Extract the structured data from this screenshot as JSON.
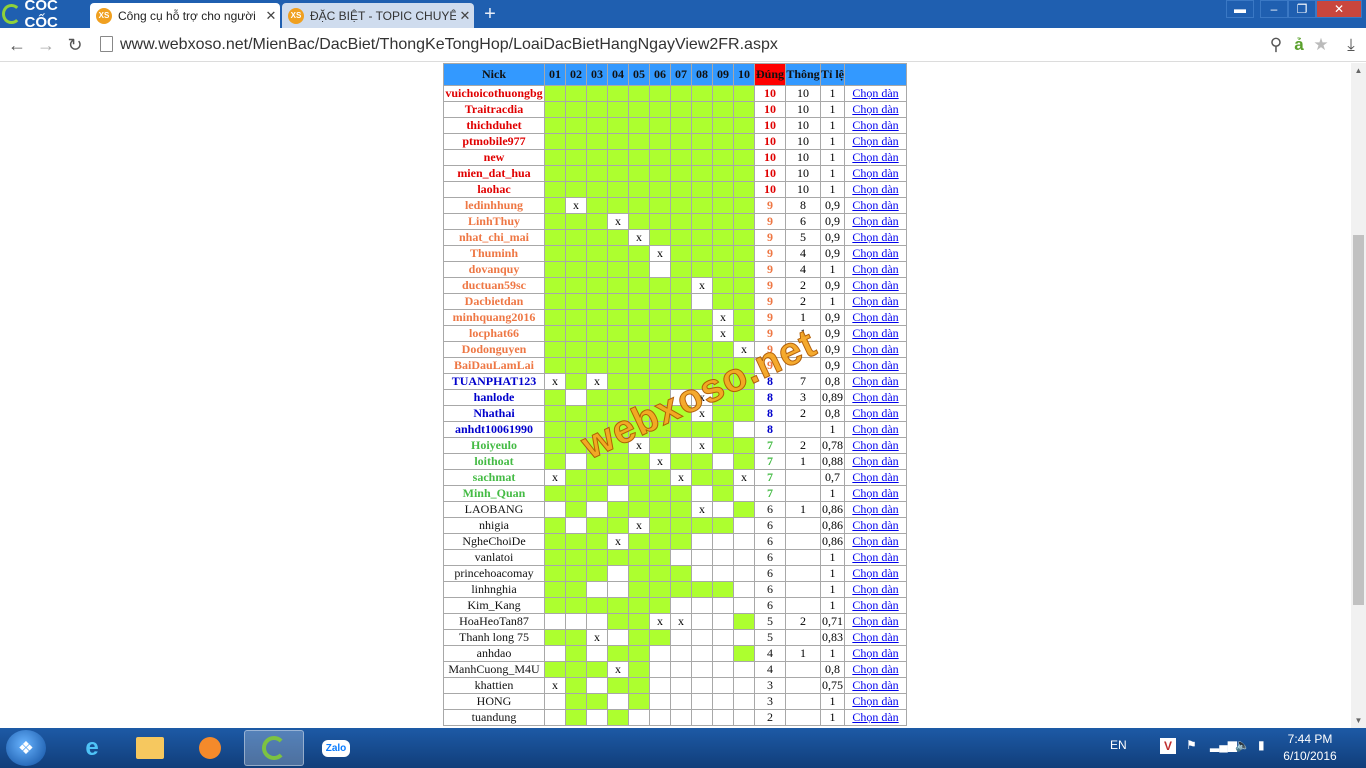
{
  "browser": {
    "brand": "CỐC CỐC",
    "tabs": [
      {
        "label": "Công cụ hỗ trợ cho người",
        "icon": "XS"
      },
      {
        "label": "ĐẶC BIỆT - TOPIC CHUYÊN",
        "icon": "XS"
      }
    ],
    "url": "www.webxoso.net/MienBac/DacBiet/ThongKeTongHop/LoaiDacBietHangNgayView2FR.aspx"
  },
  "watermark": "webxoso.net",
  "table": {
    "headers": [
      "Nick",
      "01",
      "02",
      "03",
      "04",
      "05",
      "06",
      "07",
      "08",
      "09",
      "10",
      "Đúng",
      "Thông",
      "Tỉ lệ",
      ""
    ],
    "link_label": "Chọn dàn",
    "tier_colors": {
      "10": "#e00000",
      "9": "#ee7744",
      "8": "#0000cc",
      "7": "#44bb44",
      "low": "#111111"
    },
    "rows": [
      {
        "nick": "vuichoicothuongbg",
        "cells": "1111111111",
        "dung": "10",
        "thong": "10",
        "tile": "1"
      },
      {
        "nick": "Traitracdia",
        "cells": "1111111111",
        "dung": "10",
        "thong": "10",
        "tile": "1"
      },
      {
        "nick": "thichduhet",
        "cells": "1111111111",
        "dung": "10",
        "thong": "10",
        "tile": "1"
      },
      {
        "nick": "ptmobile977",
        "cells": "1111111111",
        "dung": "10",
        "thong": "10",
        "tile": "1"
      },
      {
        "nick": "new",
        "cells": "1111111111",
        "dung": "10",
        "thong": "10",
        "tile": "1"
      },
      {
        "nick": "mien_dat_hua",
        "cells": "1111111111",
        "dung": "10",
        "thong": "10",
        "tile": "1"
      },
      {
        "nick": "laohac",
        "cells": "1111111111",
        "dung": "10",
        "thong": "10",
        "tile": "1"
      },
      {
        "nick": "ledinhhung",
        "cells": "1x11111111",
        "dung": "9",
        "thong": "8",
        "tile": "0,9"
      },
      {
        "nick": "LinhThuy",
        "cells": "111x111111",
        "dung": "9",
        "thong": "6",
        "tile": "0,9"
      },
      {
        "nick": "nhat_chi_mai",
        "cells": "1111x11111",
        "dung": "9",
        "thong": "5",
        "tile": "0,9"
      },
      {
        "nick": "Thuminh",
        "cells": "11111x1111",
        "dung": "9",
        "thong": "4",
        "tile": "0,9"
      },
      {
        "nick": "dovanquy",
        "cells": "1111101111",
        "dung": "9",
        "thong": "4",
        "tile": "1"
      },
      {
        "nick": "ductuan59sc",
        "cells": "1111111x11",
        "dung": "9",
        "thong": "2",
        "tile": "0,9"
      },
      {
        "nick": "Dacbietdan",
        "cells": "1111111011",
        "dung": "9",
        "thong": "2",
        "tile": "1"
      },
      {
        "nick": "minhquang2016",
        "cells": "11111111x1",
        "dung": "9",
        "thong": "1",
        "tile": "0,9"
      },
      {
        "nick": "locphat66",
        "cells": "11111111x1",
        "dung": "9",
        "thong": "1",
        "tile": "0,9"
      },
      {
        "nick": "Dodonguyen",
        "cells": "111111111x",
        "dung": "9",
        "thong": "",
        "tile": "0,9"
      },
      {
        "nick": "BaiDauLamLai",
        "cells": "1111111111",
        "dung": "9",
        "thong": "",
        "tile": "0,9"
      },
      {
        "nick": "TUANPHAT123",
        "cells": "x1x1111111",
        "dung": "8",
        "thong": "7",
        "tile": "0,8"
      },
      {
        "nick": "hanlode",
        "cells": "1011110x11",
        "dung": "8",
        "thong": "3",
        "tile": "0,89"
      },
      {
        "nick": "Nhathai",
        "cells": "1111111x11",
        "dung": "8",
        "thong": "2",
        "tile": "0,8"
      },
      {
        "nick": "anhdt10061990",
        "cells": "1111111110",
        "dung": "8",
        "thong": "",
        "tile": "1"
      },
      {
        "nick": "Hoiyeulo",
        "cells": "1111x10x11",
        "dung": "7",
        "thong": "2",
        "tile": "0,78"
      },
      {
        "nick": "loithoat",
        "cells": "10111x1101",
        "dung": "7",
        "thong": "1",
        "tile": "0,88"
      },
      {
        "nick": "sachmat",
        "cells": "x11111x11x",
        "dung": "7",
        "thong": "",
        "tile": "0,7"
      },
      {
        "nick": "Minh_Quan",
        "cells": "1110111010",
        "dung": "7",
        "thong": "",
        "tile": "1"
      },
      {
        "nick": "LAOBANG",
        "cells": "0101111x01",
        "dung": "6",
        "thong": "1",
        "tile": "0,86"
      },
      {
        "nick": "nhigia",
        "cells": "1011x11110",
        "dung": "6",
        "thong": "",
        "tile": "0,86"
      },
      {
        "nick": "NgheChoiDe",
        "cells": "111x111000",
        "dung": "6",
        "thong": "",
        "tile": "0,86"
      },
      {
        "nick": "vanlatoi",
        "cells": "1111110000",
        "dung": "6",
        "thong": "",
        "tile": "1"
      },
      {
        "nick": "princehoacomay",
        "cells": "1110111000",
        "dung": "6",
        "thong": "",
        "tile": "1"
      },
      {
        "nick": "linhnghia",
        "cells": "1100111110",
        "dung": "6",
        "thong": "",
        "tile": "1"
      },
      {
        "nick": "Kim_Kang",
        "cells": "1111110000",
        "dung": "6",
        "thong": "",
        "tile": "1"
      },
      {
        "nick": "HoaHeoTan87",
        "cells": "00011xx001",
        "dung": "5",
        "thong": "2",
        "tile": "0,71"
      },
      {
        "nick": "Thanh long 75",
        "cells": "11x0110000",
        "dung": "5",
        "thong": "",
        "tile": "0,83"
      },
      {
        "nick": "anhdao",
        "cells": "0101100001",
        "dung": "4",
        "thong": "1",
        "tile": "1"
      },
      {
        "nick": "ManhCuong_M4U",
        "cells": "111x100000",
        "dung": "4",
        "thong": "",
        "tile": "0,8"
      },
      {
        "nick": "khattien",
        "cells": "x101100000",
        "dung": "3",
        "thong": "",
        "tile": "0,75"
      },
      {
        "nick": "HONG",
        "cells": "0110100000",
        "dung": "3",
        "thong": "",
        "tile": "1"
      },
      {
        "nick": "tuandung",
        "cells": "0101000000",
        "dung": "2",
        "thong": "",
        "tile": "1"
      }
    ]
  },
  "taskbar": {
    "lang": "EN",
    "time": "7:44 PM",
    "date": "6/10/2016",
    "apps": [
      "ie",
      "explorer",
      "media",
      "coccoc",
      "Zalo"
    ]
  }
}
